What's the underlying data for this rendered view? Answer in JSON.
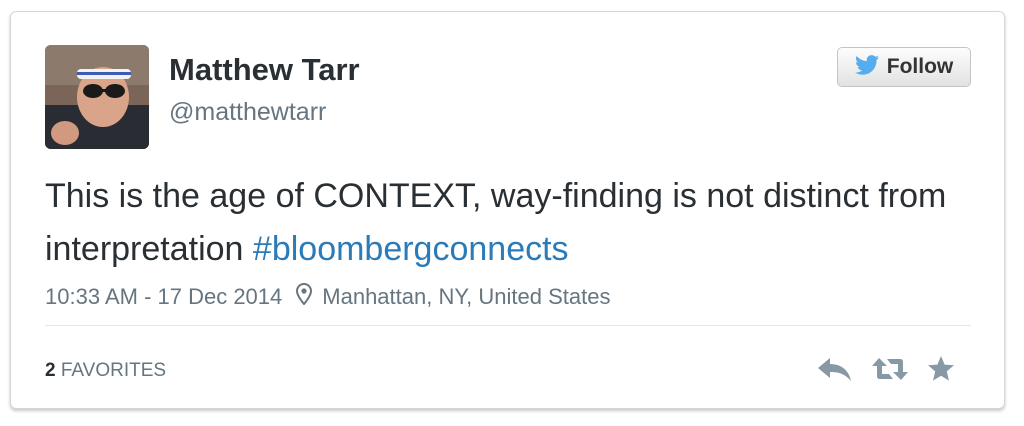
{
  "tweet": {
    "author": {
      "display_name": "Matthew Tarr",
      "screen_name": "@matthewtarr",
      "avatar_icon": "user-avatar"
    },
    "follow_button": {
      "label": "Follow",
      "icon": "twitter-bird-icon"
    },
    "text": "This is the age of CONTEXT, way-finding is not distinct from interpretation ",
    "hashtag": "#bloombergconnects",
    "timestamp": "10:33 AM - 17 Dec 2014",
    "location": {
      "icon": "location-pin-icon",
      "label": "Manhattan, NY, United States"
    },
    "stats": {
      "favorites_count": "2",
      "favorites_label": "FAVORITES"
    },
    "actions": [
      {
        "icon": "reply-icon"
      },
      {
        "icon": "retweet-icon"
      },
      {
        "icon": "favorite-star-icon"
      }
    ]
  },
  "colors": {
    "link": "#2b7bb9",
    "text": "#292f33",
    "muted": "#66757f",
    "twitter_blue": "#55acee",
    "action_icon": "#8899a6"
  }
}
